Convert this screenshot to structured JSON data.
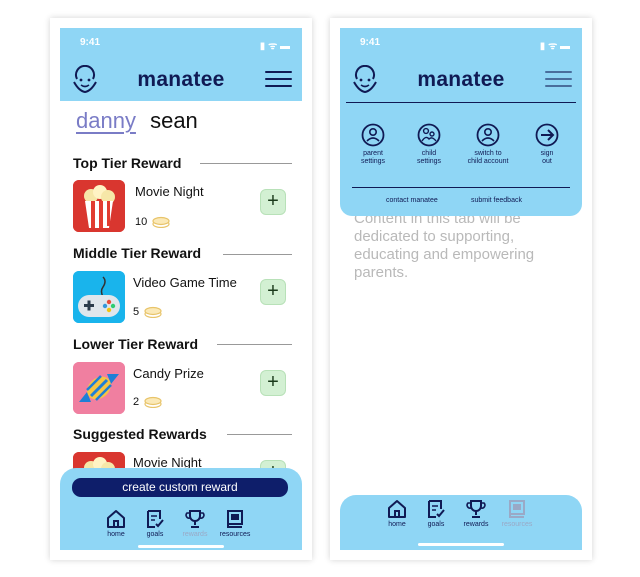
{
  "status_bar": {
    "time": "9:41",
    "system_icons": "▮ ᯤ ▬"
  },
  "brand": {
    "name": "manatee",
    "logo_icon": "smiley-face-icon",
    "menu_icon": "hamburger-menu-icon"
  },
  "children": {
    "active": "danny",
    "other": "sean"
  },
  "rewards_screen": {
    "sections": [
      {
        "title": "Top Tier Reward",
        "items": [
          {
            "name": "Movie Night",
            "cost": "10",
            "image_icon": "popcorn-icon"
          }
        ]
      },
      {
        "title": "Middle Tier Reward",
        "items": [
          {
            "name": "Video Game Time",
            "cost": "5",
            "image_icon": "game-controller-icon"
          }
        ]
      },
      {
        "title": "Lower Tier Reward",
        "items": [
          {
            "name": "Candy Prize",
            "cost": "2",
            "image_icon": "candy-icon"
          }
        ]
      },
      {
        "title": "Suggested Rewards",
        "items": [
          {
            "name": "Movie Night",
            "cost": "",
            "image_icon": "popcorn-icon"
          }
        ]
      }
    ],
    "add_label": "+",
    "create_button": "create custom reward"
  },
  "nav": {
    "items": [
      {
        "label": "home",
        "icon": "home-icon"
      },
      {
        "label": "goals",
        "icon": "checklist-icon"
      },
      {
        "label": "rewards",
        "icon": "trophy-icon"
      },
      {
        "label": "resources",
        "icon": "book-icon"
      }
    ]
  },
  "menu_overlay": {
    "items": [
      {
        "label_line1": "parent",
        "label_line2": "settings",
        "icon": "parent-user-icon"
      },
      {
        "label_line1": "child",
        "label_line2": "settings",
        "icon": "child-user-icon"
      },
      {
        "label_line1": "switch to",
        "label_line2": "child account",
        "icon": "switch-user-icon"
      },
      {
        "label_line1": "sign",
        "label_line2": "out",
        "icon": "sign-out-icon"
      }
    ],
    "links": {
      "contact": "contact manatee",
      "feedback": "submit feedback"
    },
    "background_text": "Content in this tab will be dedicated to supporting, educating and empowering parents."
  },
  "colors": {
    "header_bg": "#8fd6f5",
    "navy": "#101a54",
    "active_child": "#7a7cc6",
    "add_button": "#d3f0d3",
    "create_button": "#0e1e6a"
  }
}
